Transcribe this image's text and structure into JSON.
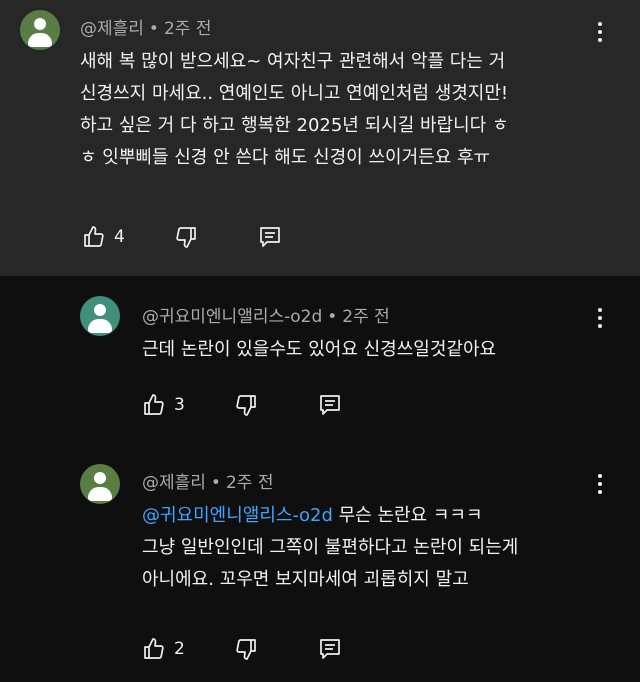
{
  "comments": [
    {
      "author": "@제흘리",
      "time": "2주 전",
      "lines": [
        "새해 복 많이 받으세요~ 여자친구 관련해서 악플 다는 거",
        "신경쓰지 마세요.. 연예인도 아니고 연예인처럼 생겻지만!",
        "하고 싶은 거 다 하고 행복한 2025년 되시길 바랍니다 ㅎ",
        "ㅎ 잇뿌삐들 신경 안 쓴다 해도 신경이 쓰이거든요 후ㅠ"
      ],
      "likes": "4"
    },
    {
      "author": "@귀요미엔니앨리스-o2d",
      "time": "2주 전",
      "lines": [
        "근데 논란이 있을수도 있어요 신경쓰일것같아요"
      ],
      "likes": "3"
    },
    {
      "author": "@제흘리",
      "time": "2주 전",
      "mention": "@귀요미엔니앨리스-o2d",
      "lines": [
        " 무슨 논란요 ㅋㅋㅋ",
        "그냥 일반인인데 그쪽이 불편하다고 논란이 되는게",
        "아니에요. 꼬우면 보지마세여 괴롭히지 말고"
      ],
      "likes": "2"
    }
  ],
  "separator": "•",
  "colors": {
    "avatar1": "#5a7d44",
    "avatar2": "#3f8f7a",
    "mention": "#3ea6ff"
  }
}
